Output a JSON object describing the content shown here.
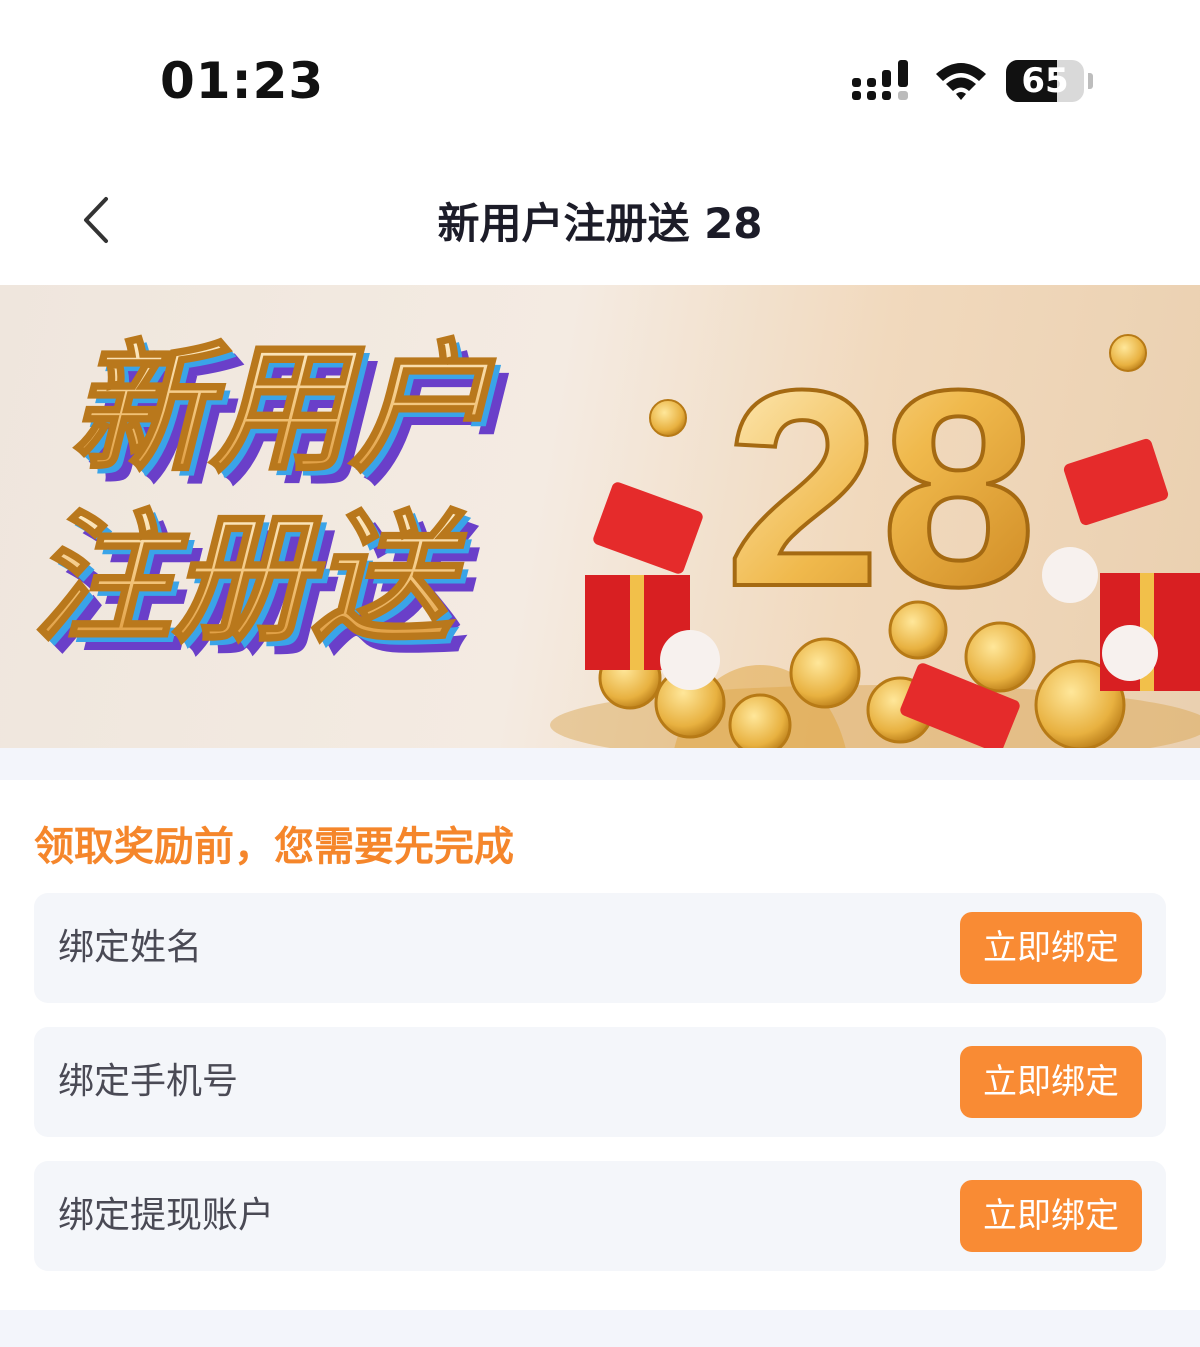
{
  "status_bar": {
    "time": "01:23",
    "battery_level": "65",
    "battery_percent": 65,
    "icons": [
      "signal-icon",
      "wifi-icon",
      "battery-icon"
    ]
  },
  "nav": {
    "title": "新用户注册送 28",
    "back_icon": "chevron-left-icon"
  },
  "banner": {
    "line1": "新用户",
    "line2": "注册送",
    "amount": "28"
  },
  "tasks": {
    "heading": "领取奖励前，您需要先完成",
    "items": [
      {
        "label": "绑定姓名",
        "button": "立即绑定"
      },
      {
        "label": "绑定手机号",
        "button": "立即绑定"
      },
      {
        "label": "绑定提现账户",
        "button": "立即绑定"
      }
    ]
  },
  "colors": {
    "accent": "#f98b34",
    "heading": "#f5862b",
    "row_bg": "#f4f6fa",
    "page_bg": "#f3f5fb"
  }
}
